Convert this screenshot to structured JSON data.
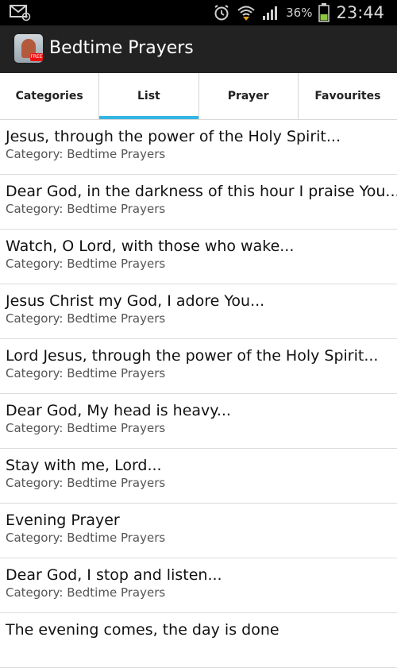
{
  "status_bar": {
    "notification_icon": "email-at-icon",
    "alarm_icon": "alarm-clock-icon",
    "wifi_icon": "wifi-icon",
    "signal_icon": "signal-bars-icon",
    "battery_percent": "36%",
    "battery_icon": "battery-icon",
    "time": "23:44"
  },
  "action_bar": {
    "app_icon": "praying-hands-app-icon",
    "app_icon_badge": "FREE",
    "title": "Bedtime Prayers"
  },
  "tabs": [
    {
      "label": "Categories",
      "active": false
    },
    {
      "label": "List",
      "active": true
    },
    {
      "label": "Prayer",
      "active": false
    },
    {
      "label": "Favourites",
      "active": false
    }
  ],
  "colors": {
    "accent": "#33b5e5",
    "action_bar": "#222222",
    "status_bar": "#000000"
  },
  "prayers": [
    {
      "title": "Jesus, through the power of the Holy Spirit...",
      "category": "Category: Bedtime Prayers"
    },
    {
      "title": "Dear God, in the darkness of this hour I praise You...",
      "category": "Category: Bedtime Prayers"
    },
    {
      "title": "Watch, O Lord, with those who wake...",
      "category": "Category: Bedtime Prayers"
    },
    {
      "title": "Jesus Christ my God, I adore You...",
      "category": "Category: Bedtime Prayers"
    },
    {
      "title": "Lord Jesus, through the power of the Holy Spirit...",
      "category": "Category: Bedtime Prayers"
    },
    {
      "title": "Dear God, My head is heavy...",
      "category": "Category: Bedtime Prayers"
    },
    {
      "title": "Stay with me, Lord...",
      "category": "Category: Bedtime Prayers"
    },
    {
      "title": "Evening Prayer",
      "category": "Category: Bedtime Prayers"
    },
    {
      "title": "Dear God, I stop and listen...",
      "category": "Category: Bedtime Prayers"
    },
    {
      "title": "The evening comes, the day is done",
      "category": ""
    }
  ]
}
